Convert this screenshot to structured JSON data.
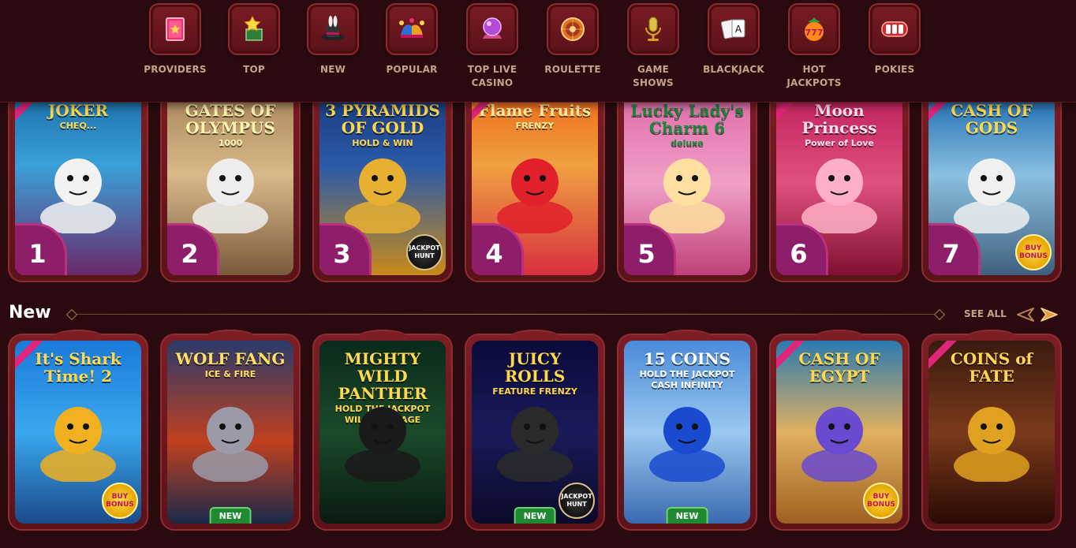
{
  "nav": {
    "categories": [
      {
        "label": "PROVIDERS",
        "icon": "book-icon"
      },
      {
        "label": "TOP",
        "icon": "star-box-icon"
      },
      {
        "label": "NEW",
        "icon": "magic-hat-icon"
      },
      {
        "label": "POPULAR",
        "icon": "jester-hat-icon"
      },
      {
        "label": "TOP LIVE CASINO",
        "icon": "crystal-ball-icon"
      },
      {
        "label": "ROULETTE",
        "icon": "roulette-wheel-icon"
      },
      {
        "label": "GAME SHOWS",
        "icon": "microphone-icon"
      },
      {
        "label": "BLACKJACK",
        "icon": "playing-cards-icon"
      },
      {
        "label": "HOT JACKPOTS",
        "icon": "lucky-777-icon"
      },
      {
        "label": "POKIES",
        "icon": "slot-reels-icon"
      }
    ]
  },
  "top_games": [
    {
      "rank": "1",
      "title": "JOKER",
      "subtitle": "CHEQ...",
      "theme": "joker",
      "exclusive": true
    },
    {
      "rank": "2",
      "title": "GATES OF OLYMPUS",
      "subtitle": "1000",
      "theme": "olympus"
    },
    {
      "rank": "3",
      "title": "3 PYRAMIDS OF GOLD",
      "subtitle": "HOLD & WIN",
      "theme": "pyramid",
      "badge": "JACKPOT HUNT"
    },
    {
      "rank": "4",
      "title": "Flame Fruits",
      "subtitle": "FRENZY",
      "theme": "fruits",
      "exclusive": true
    },
    {
      "rank": "5",
      "title": "Lucky Lady's Charm 6",
      "subtitle": "deluxe",
      "theme": "lady"
    },
    {
      "rank": "6",
      "title": "Moon Princess",
      "subtitle": "Power of Love",
      "theme": "moon",
      "exclusive": true
    },
    {
      "rank": "7",
      "title": "CASH OF GODS",
      "subtitle": "",
      "theme": "gods",
      "exclusive": true,
      "badge": "BUY BONUS"
    }
  ],
  "new_section": {
    "title": "New",
    "see_all": "SEE ALL",
    "games": [
      {
        "title": "It's Shark Time! 2",
        "subtitle": "",
        "theme": "shark",
        "exclusive": true,
        "badge": "BUY BONUS"
      },
      {
        "title": "WOLF FANG",
        "subtitle": "ICE & FIRE",
        "theme": "wolf",
        "new": "NEW"
      },
      {
        "title": "MIGHTY WILD PANTHER",
        "subtitle": "HOLD THE JACKPOT WILD RAMPAGE",
        "theme": "panther"
      },
      {
        "title": "JUICY ROLLS",
        "subtitle": "FEATURE FRENZY",
        "theme": "juicy",
        "new": "NEW",
        "badge": "JACKPOT HUNT"
      },
      {
        "title": "15 COINS",
        "subtitle": "HOLD THE JACKPOT CASH INFINITY",
        "theme": "coins",
        "new": "NEW"
      },
      {
        "title": "CASH OF EGYPT",
        "subtitle": "",
        "theme": "egypt",
        "exclusive": true,
        "badge": "BUY BONUS"
      },
      {
        "title": "COINS of FATE",
        "subtitle": "",
        "theme": "fate",
        "exclusive": true
      }
    ]
  },
  "colors": {
    "background": "#2a0a0e",
    "card_frame": "#7d1d25",
    "label": "#c7a28a",
    "rank_badge": "#8e1d6a",
    "new_tag": "#1f8a32"
  }
}
